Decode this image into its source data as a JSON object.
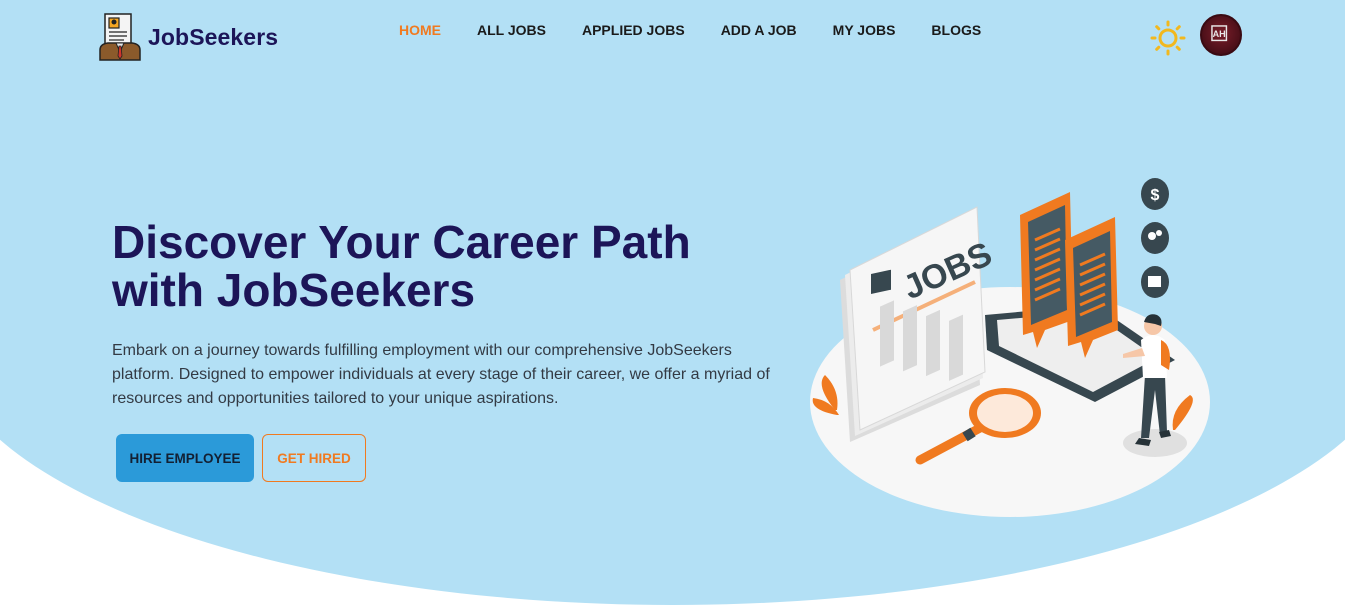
{
  "brand": {
    "name": "JobSeekers",
    "logo_icon": "resume-badge-icon"
  },
  "nav": {
    "items": [
      {
        "label": "HOME",
        "active": true
      },
      {
        "label": "ALL JOBS",
        "active": false
      },
      {
        "label": "APPLIED JOBS",
        "active": false
      },
      {
        "label": "ADD A JOB",
        "active": false
      },
      {
        "label": "MY JOBS",
        "active": false
      },
      {
        "label": "BLOGS",
        "active": false
      }
    ]
  },
  "header_actions": {
    "theme_icon": "sun-icon",
    "avatar_text": "AH"
  },
  "hero": {
    "title_line1": "Discover Your Career Path",
    "title_line2": "with JobSeekers",
    "description": "Embark on a journey towards fulfilling employment with our comprehensive JobSeekers platform. Designed to empower individuals at every stage of their career, we offer a myriad of resources and opportunities tailored to your unique aspirations.",
    "primary_button": "HIRE EMPLOYEE",
    "secondary_button": "GET HIRED",
    "illustration_text": "JOBS"
  },
  "colors": {
    "hero_bg": "#b3e0f5",
    "accent": "#f07a20",
    "primary": "#2b9ad9",
    "heading": "#1c1558"
  }
}
